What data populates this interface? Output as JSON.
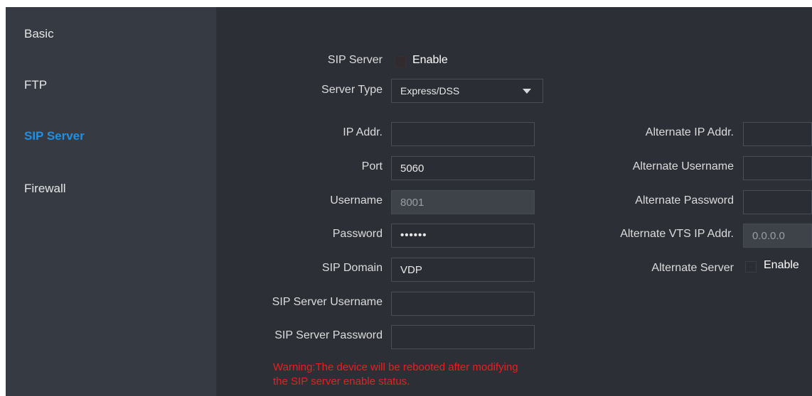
{
  "sidebar": {
    "items": [
      {
        "label": "Basic"
      },
      {
        "label": "FTP"
      },
      {
        "label": "SIP Server"
      },
      {
        "label": "Firewall"
      }
    ]
  },
  "form": {
    "sip_server_label": "SIP Server",
    "enable_label": "Enable",
    "server_type_label": "Server Type",
    "server_type_value": "Express/DSS",
    "ip_addr_label": "IP Addr.",
    "ip_addr_value": "",
    "port_label": "Port",
    "port_value": "5060",
    "username_label": "Username",
    "username_value": "8001",
    "password_label": "Password",
    "password_value": "••••••",
    "sip_domain_label": "SIP Domain",
    "sip_domain_value": "VDP",
    "sip_server_username_label": "SIP Server Username",
    "sip_server_username_value": "",
    "sip_server_password_label": "SIP Server Password",
    "sip_server_password_value": "",
    "alt_ip_label": "Alternate IP Addr.",
    "alt_ip_value": "",
    "alt_username_label": "Alternate Username",
    "alt_username_value": "",
    "alt_password_label": "Alternate Password",
    "alt_password_value": "",
    "alt_vts_label": "Alternate VTS IP Addr.",
    "alt_vts_value": "0.0.0.0",
    "alt_server_label": "Alternate Server",
    "alt_enable_label": "Enable",
    "warning_line1": "Warning:The device will be rebooted after modifying",
    "warning_line2": "the SIP server enable status."
  },
  "colors": {
    "active_nav": "#1e90e6",
    "warning": "#e82020",
    "panel_bg": "#2c2f36",
    "sidebar_bg": "#363a42"
  }
}
